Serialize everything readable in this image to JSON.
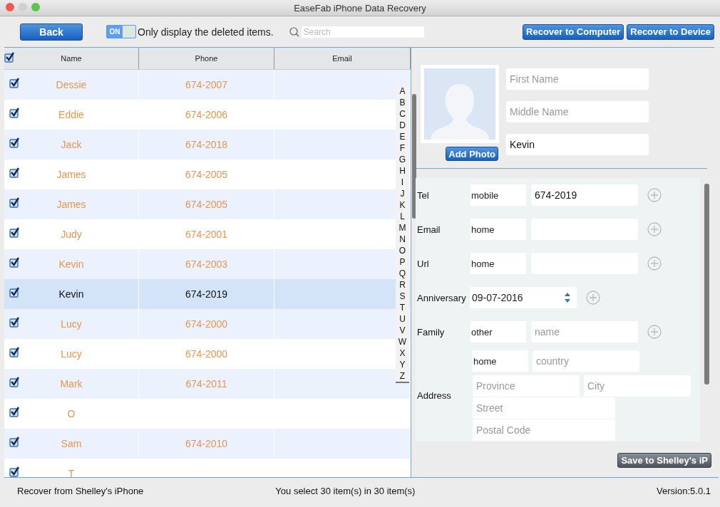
{
  "window": {
    "title": "EaseFab iPhone Data Recovery"
  },
  "toolbar": {
    "back": "Back",
    "toggle": {
      "label": "ON",
      "on": true
    },
    "toggle_text": "Only display the deleted items.",
    "search": {
      "placeholder": "Search"
    },
    "buttons": [
      "Recover to Computer",
      "Recover to Device"
    ]
  },
  "table": {
    "select_all": {
      "checked": true
    },
    "columns": [
      "Name",
      "Phone",
      "Email"
    ],
    "rows": [
      {
        "name": "Dessie",
        "phone": "674-2007",
        "checked": true,
        "selected": false,
        "deleted": true
      },
      {
        "name": "Eddie",
        "phone": "674-2006",
        "checked": true,
        "selected": false,
        "deleted": true
      },
      {
        "name": "Jack",
        "phone": "674-2018",
        "checked": true,
        "selected": false,
        "deleted": true
      },
      {
        "name": "James",
        "phone": "674-2005",
        "checked": true,
        "selected": false,
        "deleted": true
      },
      {
        "name": "James",
        "phone": "674-2005",
        "checked": true,
        "selected": false,
        "deleted": true
      },
      {
        "name": "Judy",
        "phone": "674-2001",
        "checked": true,
        "selected": false,
        "deleted": true
      },
      {
        "name": "Kevin",
        "phone": "674-2003",
        "checked": true,
        "selected": false,
        "deleted": true
      },
      {
        "name": "Kevin",
        "phone": "674-2019",
        "checked": true,
        "selected": true,
        "deleted": false
      },
      {
        "name": "Lucy",
        "phone": "674-2000",
        "checked": true,
        "selected": false,
        "deleted": true
      },
      {
        "name": "Lucy",
        "phone": "674-2000",
        "checked": true,
        "selected": false,
        "deleted": true
      },
      {
        "name": "Mark",
        "phone": "674-2011",
        "checked": true,
        "selected": false,
        "deleted": true
      },
      {
        "name": "O",
        "phone": "",
        "checked": true,
        "selected": false,
        "deleted": true
      },
      {
        "name": "Sam",
        "phone": "674-2010",
        "checked": true,
        "selected": false,
        "deleted": true
      },
      {
        "name": "T",
        "phone": "",
        "checked": true,
        "selected": false,
        "deleted": true
      }
    ],
    "index_letters": [
      "A",
      "B",
      "C",
      "D",
      "E",
      "F",
      "G",
      "H",
      "I",
      "J",
      "K",
      "L",
      "M",
      "N",
      "O",
      "P",
      "Q",
      "R",
      "S",
      "T",
      "U",
      "V",
      "W",
      "X",
      "Y",
      "Z"
    ]
  },
  "contact": {
    "add_photo": "Add Photo",
    "first_name": {
      "placeholder": "First Name"
    },
    "middle_name": {
      "placeholder": "Middle Name"
    },
    "last_name": {
      "value": "Kevin"
    },
    "fields": [
      {
        "kind": "field",
        "label": "Tel",
        "type": "mobile",
        "value": "674-2019"
      },
      {
        "kind": "field",
        "label": "Email",
        "type": "home"
      },
      {
        "kind": "field",
        "label": "Url",
        "type": "home"
      },
      {
        "kind": "date",
        "label": "Anniversary",
        "value": "09-07-2016"
      },
      {
        "kind": "field",
        "label": "Family",
        "type": "other",
        "placeholder": "name"
      },
      {
        "kind": "address",
        "label": "Address",
        "type": "home",
        "country": {
          "placeholder": "country"
        },
        "province": {
          "placeholder": "Province"
        },
        "city": {
          "placeholder": "City"
        },
        "street": {
          "placeholder": "Street"
        },
        "postal_code": {
          "placeholder": "Postal Code"
        }
      }
    ],
    "save": "Save to Shelley's iP"
  },
  "status_bar": {
    "source": "Recover from Shelley's iPhone",
    "selection": "You select 30 item(s) in 30 item(s)",
    "version": "Version:5.0.1"
  }
}
